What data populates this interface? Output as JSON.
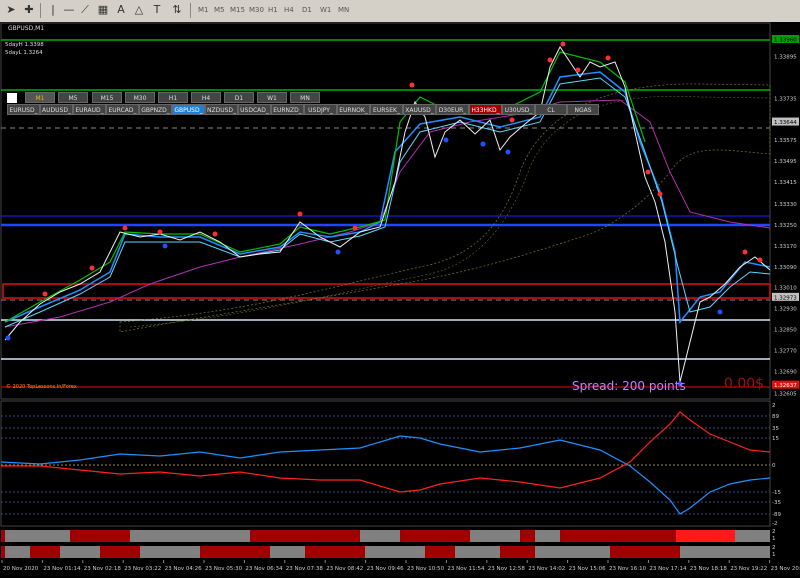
{
  "toolbar": {
    "timeframes": [
      "M1",
      "M5",
      "M15",
      "M30",
      "H1",
      "H4",
      "D1",
      "W1",
      "MN"
    ],
    "icons": [
      "cursor-icon",
      "crosshair-icon",
      "vertical-line-icon",
      "horizontal-line-icon",
      "trend-line-icon",
      "channel-icon",
      "text-icon",
      "shapes-icon"
    ]
  },
  "chart": {
    "symbol_title": "GBPUSD,M1",
    "info_line1": "5dayH 1.3398",
    "info_line2": "5dayL 1.3264",
    "copyright": "© 2020 TopLessons.In/Forex",
    "spread_text": "Spread: 200 points",
    "profit_text": "0.00$",
    "timeframe_buttons": [
      "M1",
      "M5",
      "M15",
      "M30",
      "H1",
      "H4",
      "D1",
      "W1",
      "MN"
    ],
    "active_timeframe": "M1",
    "symbol_buttons": [
      "EURUSD_",
      "AUDUSD_",
      "EURAUD_",
      "EURCAD_",
      "GBPNZD_",
      "GBPUSD_",
      "NZDUSD_",
      "USDCAD_",
      "EURNZD_",
      "USDJPY_",
      "EURNOK_",
      "EURSEK_",
      "XAUUSD_",
      "D30EUR_",
      "H33HKD_",
      "U30USD_",
      "CL",
      "NGAS"
    ],
    "active_symbol": "GBPUSD_",
    "highlight_symbol": "H33HKD_",
    "price_labels": [
      "1.33960",
      "1.33895",
      "1.33735",
      "1.33644",
      "1.33575",
      "1.33495",
      "1.33415",
      "1.33330",
      "1.33250",
      "1.33170",
      "1.33090",
      "1.33010",
      "1.32973",
      "1.32930",
      "1.32850",
      "1.32770",
      "1.32690",
      "1.32637",
      "1.32605"
    ],
    "highlighted_prices": {
      "top": "1.33960",
      "current": "1.33644",
      "bid": "1.32973",
      "low": "1.32637"
    },
    "indicator_labels": [
      "2",
      "89",
      "35",
      "15",
      "0",
      "-15",
      "-35",
      "-89",
      "-2"
    ],
    "bar_indicator_labels": [
      "2",
      "1",
      "2",
      "1"
    ],
    "time_labels": [
      "20 Nov 2020",
      "23 Nov 01:14",
      "23 Nov 02:18",
      "23 Nov 03:22",
      "23 Nov 04:26",
      "23 Nov 05:30",
      "23 Nov 06:34",
      "23 Nov 07:38",
      "23 Nov 08:42",
      "23 Nov 09:46",
      "23 Nov 10:50",
      "23 Nov 11:54",
      "23 Nov 12:58",
      "23 Nov 14:02",
      "23 Nov 15:06",
      "23 Nov 16:10",
      "23 Nov 17:14",
      "23 Nov 18:18",
      "23 Nov 19:22",
      "23 Nov 20:26"
    ],
    "colors": {
      "bull": "#ff3030",
      "bear": "#1e90ff",
      "bar_red": "#a00000",
      "bar_gray": "#808080",
      "bar_bright": "#ff1a1a"
    }
  }
}
